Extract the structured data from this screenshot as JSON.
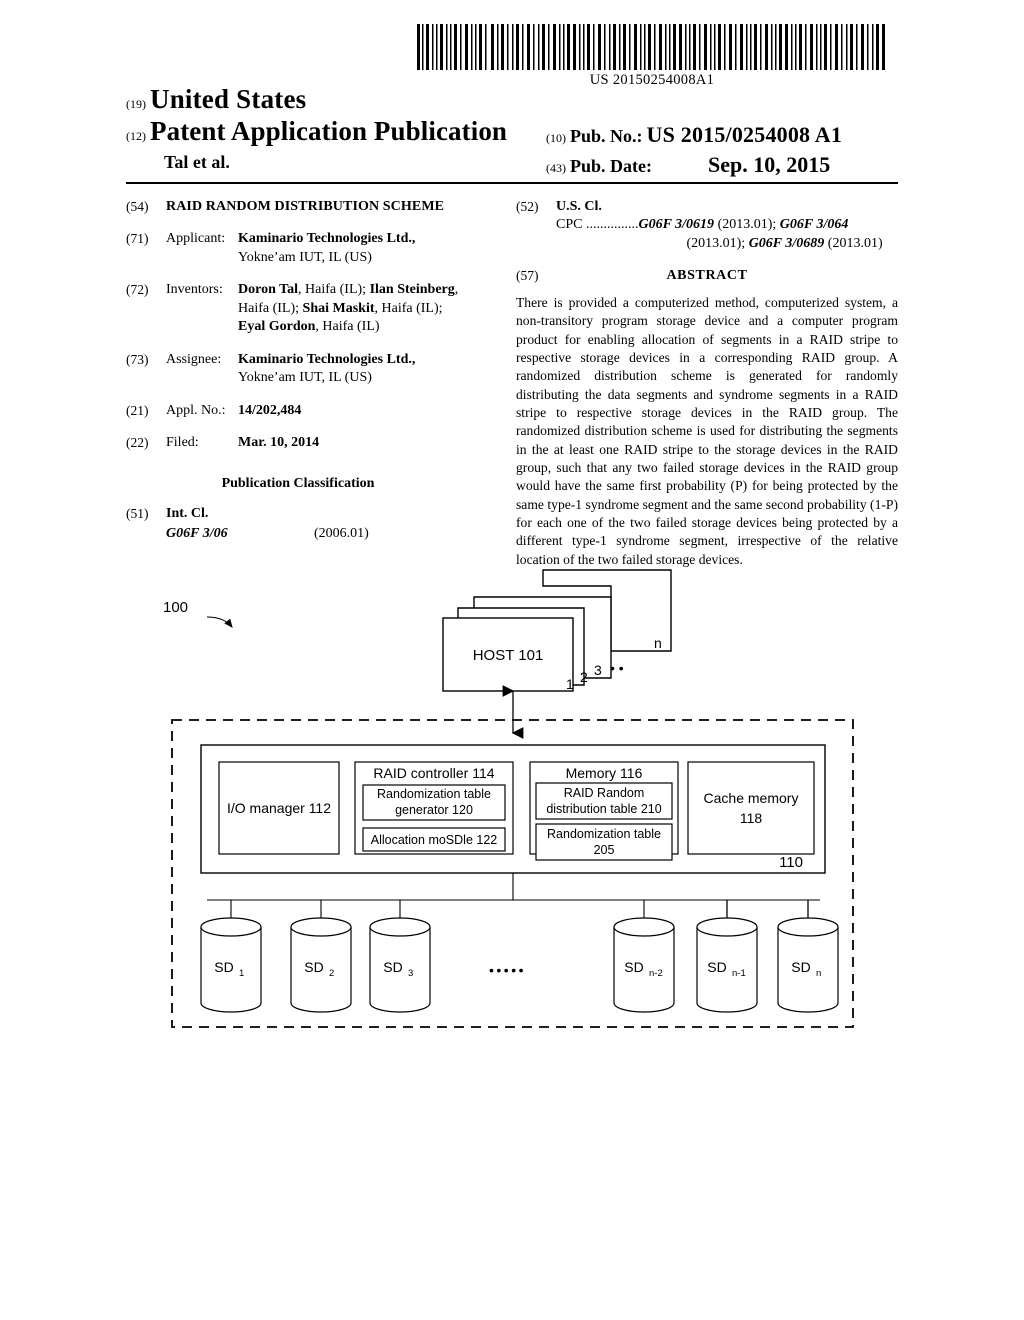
{
  "document": {
    "barcode_number": "US 20150254008A1",
    "country_code": "(19)",
    "country": "United States",
    "doc_type_code": "(12)",
    "doc_type": "Patent Application Publication",
    "author_line": "Tal et al.",
    "pub_no_code": "(10)",
    "pub_no_label": "Pub. No.:",
    "pub_no_value": "US 2015/0254008 A1",
    "pub_date_code": "(43)",
    "pub_date_label": "Pub. Date:",
    "pub_date_value": "Sep. 10, 2015"
  },
  "left_column": {
    "title_code": "(54)",
    "title": "RAID RANDOM DISTRIBUTION SCHEME",
    "applicant_code": "(71)",
    "applicant_label": "Applicant:",
    "applicant_name": "Kaminario Technologies Ltd.,",
    "applicant_address": "Yokne’am IUT, IL (US)",
    "inventors_code": "(72)",
    "inventors_label": "Inventors:",
    "inventors_line1_name": "Doron Tal",
    "inventors_line1_rest": ", Haifa (IL); ",
    "inventors_line1_name2": "Ilan Steinberg",
    "inventors_line1_tail": ",",
    "inventors_line2_lead": "Haifa (IL); ",
    "inventors_line2_name": "Shai Maskit",
    "inventors_line2_rest": ", Haifa (IL);",
    "inventors_line3_name": "Eyal Gordon",
    "inventors_line3_rest": ", Haifa (IL)",
    "assignee_code": "(73)",
    "assignee_label": "Assignee:",
    "assignee_name": "Kaminario Technologies Ltd.,",
    "assignee_address": "Yokne’am IUT, IL (US)",
    "appl_no_code": "(21)",
    "appl_no_label": "Appl. No.:",
    "appl_no_value": "14/202,484",
    "filed_code": "(22)",
    "filed_label": "Filed:",
    "filed_value": "Mar. 10, 2014",
    "pub_class_heading": "Publication Classification",
    "int_cl_code": "(51)",
    "int_cl_label": "Int. Cl.",
    "int_cl_class": "G06F 3/06",
    "int_cl_version": "(2006.01)"
  },
  "right_column": {
    "us_cl_code": "(52)",
    "us_cl_label": "U.S. Cl.",
    "cpc_label": "CPC ...............",
    "cpc_line1_a": "G06F 3/0619",
    "cpc_line1_b": " (2013.01); ",
    "cpc_line1_c": "G06F 3/064",
    "cpc_line2_a": "(2013.01); ",
    "cpc_line2_b": "G06F 3/0689",
    "cpc_line2_c": " (2013.01)",
    "abstract_code": "(57)",
    "abstract_title": "ABSTRACT",
    "abstract_text": "There is provided a computerized method, computerized system, a non-transitory program storage device and a computer program product for enabling allocation of segments in a RAID stripe to respective storage devices in a corresponding RAID group. A randomized distribution scheme is generated for randomly distributing the data segments and syndrome segments in a RAID stripe to respective storage devices in the RAID group. The randomized distribution scheme is used for distributing the segments in the at least one RAID stripe to the storage devices in the RAID group, such that any two failed storage devices in the RAID group would have the same first probability (P) for being protected by the same type-1 syndrome segment and the same second probability (1-P) for each one of the two failed storage devices being protected by a different type-1 syndrome segment, irrespective of the relative location of the two failed storage devices."
  },
  "figure": {
    "system_ref": "100",
    "host_label": "HOST 101",
    "host_stack_indices": [
      "1",
      "2",
      "3",
      "n"
    ],
    "host_ellipsis": "• •",
    "storage_system_ref": "110",
    "blocks": {
      "io_manager": "I/O manager 112",
      "raid_controller": "RAID controller 114",
      "randomization_generator": "Randomization table generator 120",
      "allocation_module": "Allocation moSDle 122",
      "memory": "Memory 116",
      "raid_random_table": "RAID Random distribution table 210",
      "randomization_table": "Randomization table 205",
      "cache_memory": "Cache memory 118"
    },
    "storage_devices": [
      {
        "base": "SD",
        "sub": "1"
      },
      {
        "base": "SD",
        "sub": "2"
      },
      {
        "base": "SD",
        "sub": "3"
      },
      {
        "base": "SD",
        "sub": "n-2"
      },
      {
        "base": "SD",
        "sub": "n-1"
      },
      {
        "base": "SD",
        "sub": "n"
      }
    ],
    "devices_ellipsis": "•••••"
  }
}
